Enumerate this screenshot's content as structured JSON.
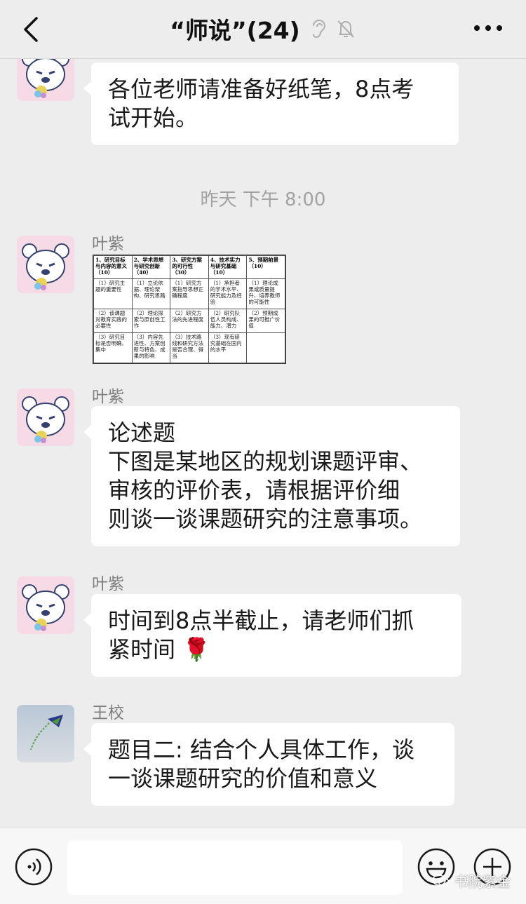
{
  "nav": {
    "title": "“师说”(24)"
  },
  "messages": [
    {
      "sender": "",
      "lines": [
        "各位老师请准备好纸笔，8点考",
        "试开始。"
      ]
    },
    {
      "timestamp": "昨天 下午 8:00"
    },
    {
      "sender": "叶紫",
      "type": "image",
      "image_table": {
        "headers": [
          "1、研究目标与内容的意义（10）",
          "2、学术思想与研究创新（40）",
          "3、研究方案的可行性（30）",
          "4、技术实力与研究基础（10）",
          "5、预期前景（10）"
        ],
        "rows": [
          [
            "（1）研究主题的重要性",
            "（1）立论依据、理论架构、研究思路",
            "（1）研究方案指导思想正确程度",
            "（1）承担者的学术水平、研究能力及经验",
            "（1）理论成果或质量提升、培养教师的可能性"
          ],
          [
            "（2）该课题对教育实践的必要性",
            "（2）理论探索与原创性工作",
            "（2）研究方法的先进程度",
            "（2）研究队伍人员构成、能力、潜力",
            "（2）预期成果的可推广价值"
          ],
          [
            "（3）研究目标是否明确、集中",
            "（3）内容先进性、方案创新与特色、成果的影响",
            "（3）技术路线和研究方法是否合理、得当",
            "（3）现有研究基础在国内的水平",
            ""
          ]
        ]
      }
    },
    {
      "sender": "叶紫",
      "lines": [
        "论述题",
        "下图是某地区的规划课题评审、",
        "审核的评价表，请根据评价细",
        "则谈一谈课题研究的注意事项。"
      ]
    },
    {
      "sender": "叶紫",
      "lines": [
        "时间到8点半截止，请老师们抓",
        "紧时间 🌹"
      ]
    },
    {
      "sender": "王校",
      "lines": [
        "题目二: 结合个人具体工作，谈",
        "一谈课题研究的价值和意义"
      ]
    }
  ],
  "input": {
    "placeholder": ""
  },
  "watermark": "书院紫金",
  "colors": {
    "background": "#ededed",
    "bubble": "#ffffff",
    "accent_rose": "#d3273e"
  },
  "icons": [
    "back-icon",
    "ear-icon",
    "mute-icon",
    "more-icon",
    "voice-icon",
    "emoji-icon",
    "plus-icon"
  ]
}
